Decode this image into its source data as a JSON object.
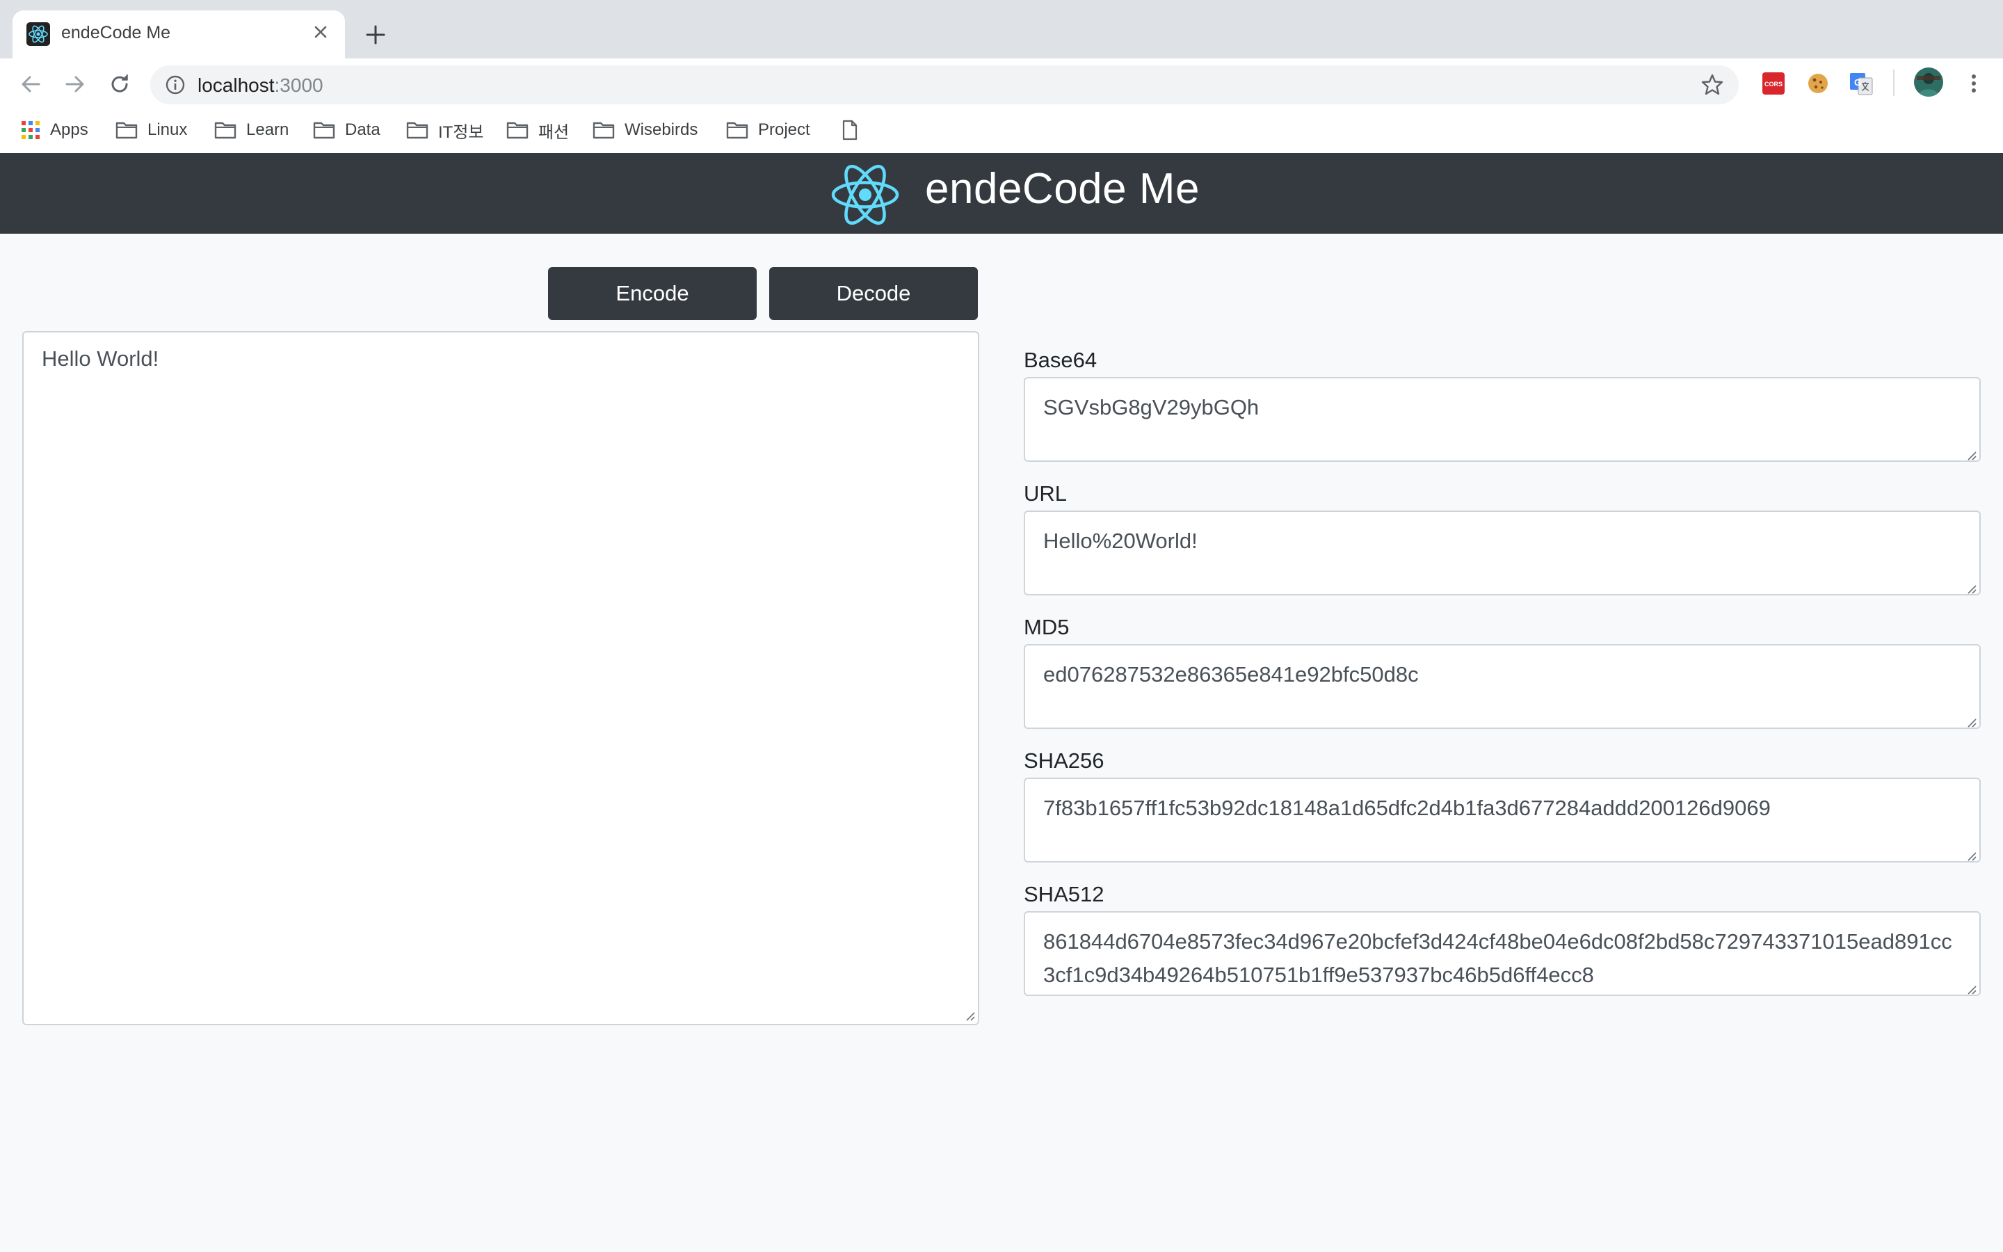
{
  "browser": {
    "tab_title": "endeCode Me",
    "url_host": "localhost",
    "url_port": ":3000",
    "bookmarks": [
      "Apps",
      "Linux",
      "Learn",
      "Data",
      "IT정보",
      "패션",
      "Wisebirds",
      "Project"
    ],
    "extensions": [
      "cors-icon",
      "cookie-icon",
      "translate-icon"
    ]
  },
  "app": {
    "title": "endeCode Me",
    "logo_color": "#61dafb",
    "header_color": "#343a40",
    "encode_label": "Encode",
    "decode_label": "Decode",
    "input_text": "Hello World!"
  },
  "outputs": [
    {
      "label": "Base64",
      "value": "SGVsbG8gV29ybGQh"
    },
    {
      "label": "URL",
      "value": "Hello%20World!"
    },
    {
      "label": "MD5",
      "value": "ed076287532e86365e841e92bfc50d8c"
    },
    {
      "label": "SHA256",
      "value": "7f83b1657ff1fc53b92dc18148a1d65dfc2d4b1fa3d677284addd200126d9069"
    },
    {
      "label": "SHA512",
      "value": "861844d6704e8573fec34d967e20bcfef3d424cf48be04e6dc08f2bd58c729743371015ead891cc3cf1c9d34b49264b510751b1ff9e537937bc46b5d6ff4ecc8"
    }
  ]
}
